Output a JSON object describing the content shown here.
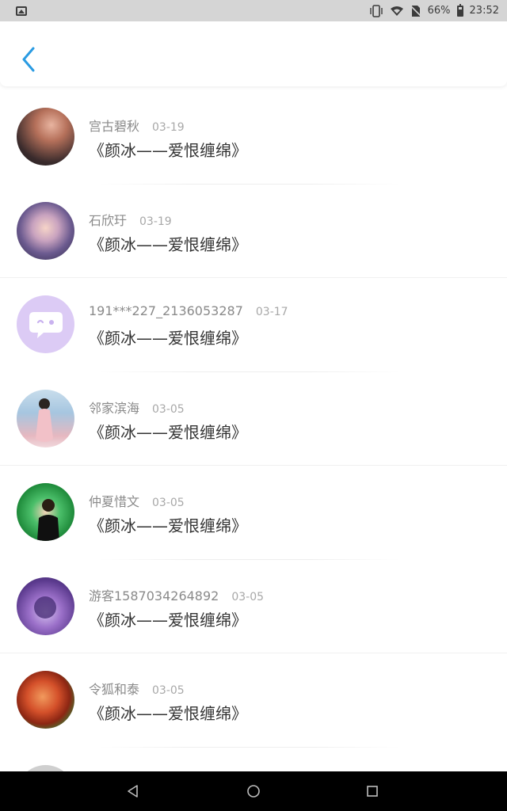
{
  "status_bar": {
    "battery": "66%",
    "time": "23:52",
    "icons": [
      "image-notification-icon",
      "vibrate-icon",
      "wifi-icon",
      "no-sim-icon",
      "battery-icon"
    ],
    "battery_level": 0.66
  },
  "header": {
    "back_icon": "chevron-left-icon",
    "accent_color": "#2a9be2"
  },
  "comments": [
    {
      "username": "宫古碧秋",
      "date": "03-19",
      "text": "《颜冰——爱恨缠绵》",
      "avatar": "user-photo"
    },
    {
      "username": "石欣玗",
      "date": "03-19",
      "text": "《颜冰——爱恨缠绵》",
      "avatar": "anime-avatar"
    },
    {
      "username": "191***227_2136053287",
      "date": "03-17",
      "text": "《颜冰——爱恨缠绵》",
      "avatar": "default-chat-avatar"
    },
    {
      "username": "邻家滨海",
      "date": "03-05",
      "text": "《颜冰——爱恨缠绵》",
      "avatar": "user-photo"
    },
    {
      "username": "仲夏惜文",
      "date": "03-05",
      "text": "《颜冰——爱恨缠绵》",
      "avatar": "user-photo"
    },
    {
      "username": "游客1587034264892",
      "date": "03-05",
      "text": "《颜冰——爱恨缠绵》",
      "avatar": "user-photo"
    },
    {
      "username": "令狐和泰",
      "date": "03-05",
      "text": "《颜冰——爱恨缠绵》",
      "avatar": "food-photo"
    }
  ],
  "nav_bar": {
    "buttons": [
      "back-triangle-icon",
      "home-circle-icon",
      "recents-square-icon"
    ]
  }
}
